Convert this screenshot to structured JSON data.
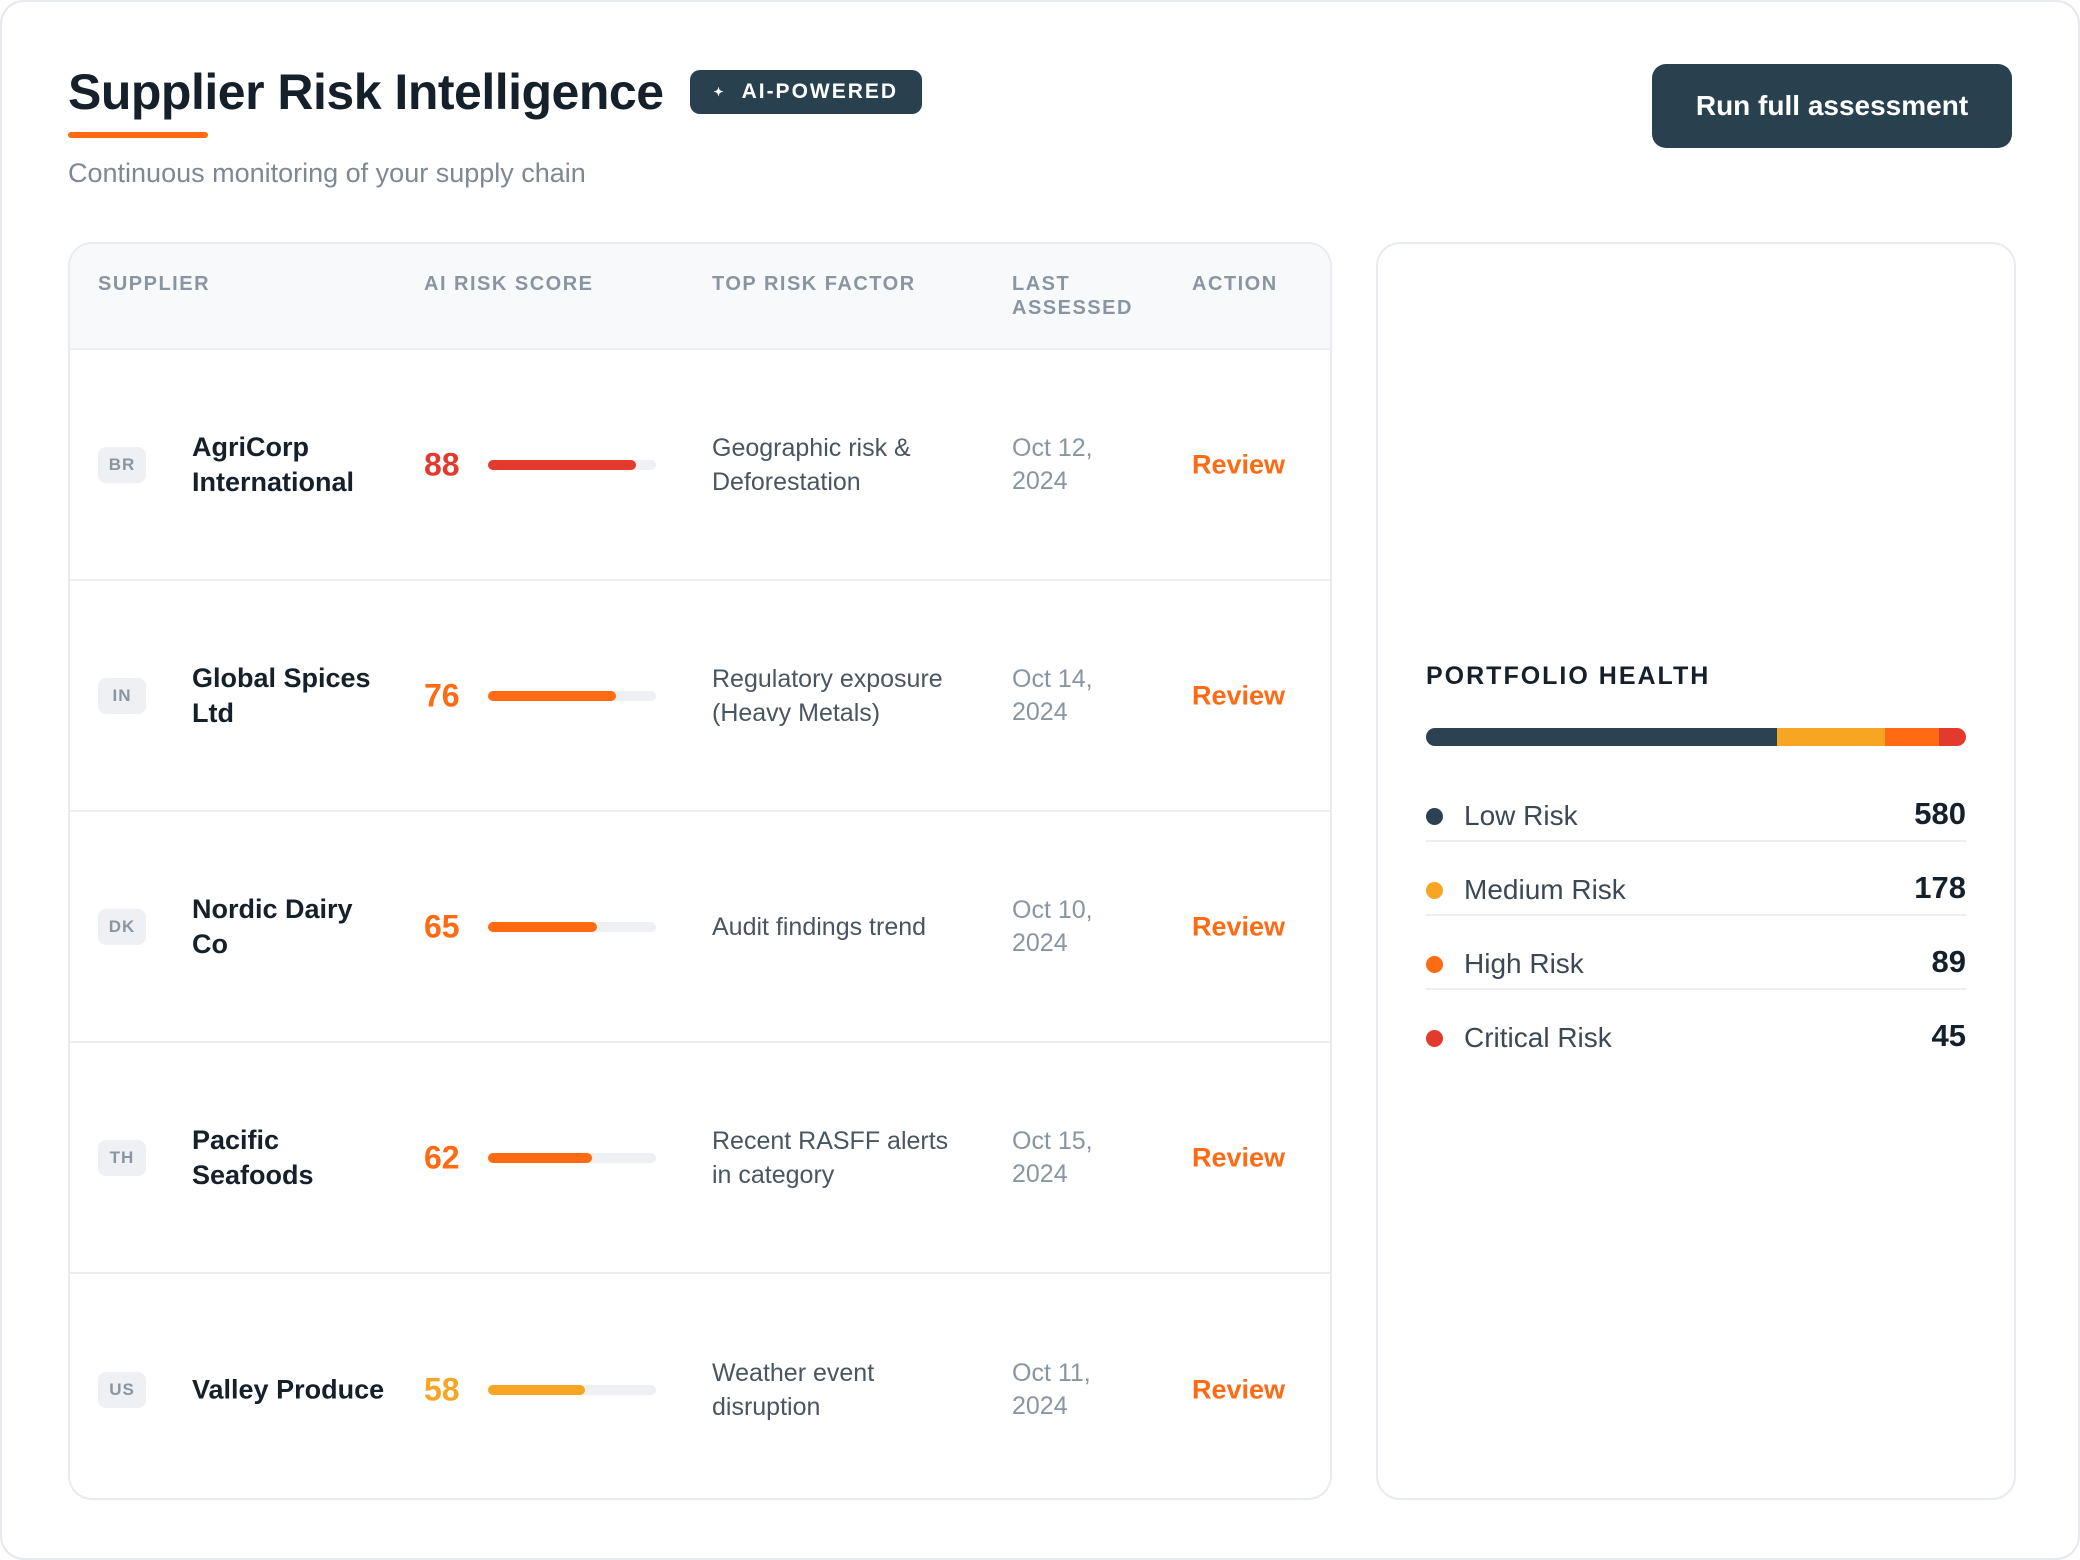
{
  "header": {
    "title": "Supplier Risk Intelligence",
    "badge": "AI-POWERED",
    "badge_icon": "sparkle-icon",
    "subtitle": "Continuous monitoring of your supply chain",
    "primary_action": "Run full assessment"
  },
  "table": {
    "columns": [
      "SUPPLIER",
      "AI RISK SCORE",
      "TOP RISK FACTOR",
      "LAST ASSESSED",
      "ACTION"
    ],
    "rows": [
      {
        "country": "BR",
        "supplier": "AgriCorp International",
        "score": "88",
        "score_value": 88,
        "score_color": "#e23b2e",
        "risk_factor": "Geographic risk & Deforestation",
        "last_assessed": "Oct 12, 2024",
        "action": "Review"
      },
      {
        "country": "IN",
        "supplier": "Global Spices Ltd",
        "score": "76",
        "score_value": 76,
        "score_color": "#ff6a13",
        "risk_factor": "Regulatory exposure (Heavy Metals)",
        "last_assessed": "Oct 14, 2024",
        "action": "Review"
      },
      {
        "country": "DK",
        "supplier": "Nordic Dairy Co",
        "score": "65",
        "score_value": 65,
        "score_color": "#ff6a13",
        "risk_factor": "Audit findings trend",
        "last_assessed": "Oct 10, 2024",
        "action": "Review"
      },
      {
        "country": "TH",
        "supplier": "Pacific Seafoods",
        "score": "62",
        "score_value": 62,
        "score_color": "#ff6a13",
        "risk_factor": "Recent RASFF alerts in category",
        "last_assessed": "Oct 15, 2024",
        "action": "Review"
      },
      {
        "country": "US",
        "supplier": "Valley Produce",
        "score": "58",
        "score_value": 58,
        "score_color": "#f6a623",
        "risk_factor": "Weather event disruption",
        "last_assessed": "Oct 11, 2024",
        "action": "Review"
      }
    ]
  },
  "portfolio": {
    "title": "PORTFOLIO HEALTH",
    "segments": [
      {
        "label": "Low Risk",
        "count": "580",
        "value": 580,
        "color": "#2c4252"
      },
      {
        "label": "Medium Risk",
        "count": "178",
        "value": 178,
        "color": "#f6a623"
      },
      {
        "label": "High Risk",
        "count": "89",
        "value": 89,
        "color": "#ff6a13"
      },
      {
        "label": "Critical Risk",
        "count": "45",
        "value": 45,
        "color": "#e23b2e"
      }
    ]
  }
}
